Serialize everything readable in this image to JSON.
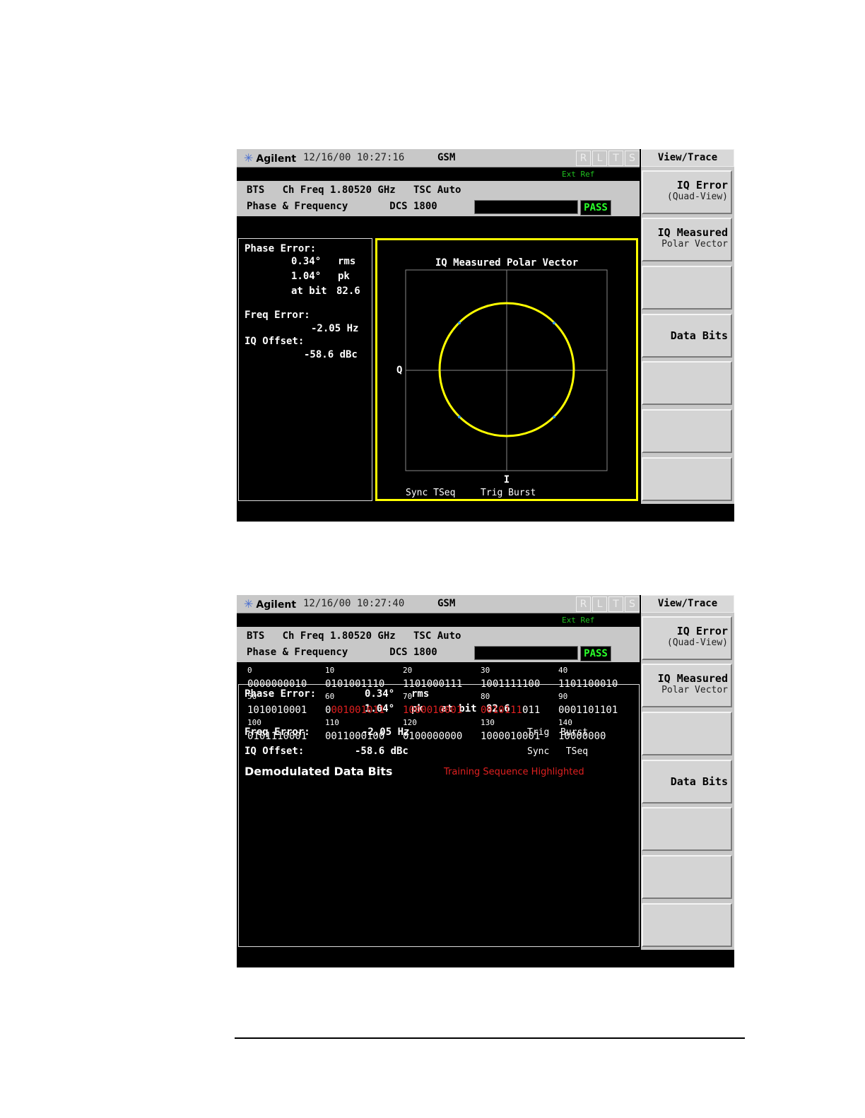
{
  "screen1": {
    "brand": "Agilent",
    "timestamp": "12/16/00 10:27:16",
    "mode": "GSM",
    "status_letters": [
      "R",
      "L",
      "T",
      "S"
    ],
    "ext_ref": "Ext Ref",
    "header_line1": "BTS   Ch Freq 1.80520 GHz   TSC Auto",
    "header_line2": "Phase & Frequency       DCS 1800",
    "pass": "PASS",
    "results": {
      "phase_error_label": "Phase Error:",
      "rms_value": "0.34°",
      "rms_unit": "rms",
      "pk_value": "1.04°",
      "pk_unit": "pk",
      "at_bit_label": "at bit",
      "at_bit_value": "82.6",
      "freq_error_label": "Freq Error:",
      "freq_error_value": "-2.05 Hz",
      "iq_offset_label": "IQ Offset:",
      "iq_offset_value": "-58.6 dBc"
    },
    "graph": {
      "title": "IQ Measured Polar Vector",
      "y_axis": "Q",
      "x_axis": "I",
      "sync_label": "Sync TSeq",
      "trig_label": "Trig Burst"
    }
  },
  "screen2": {
    "brand": "Agilent",
    "timestamp": "12/16/00 10:27:40",
    "mode": "GSM",
    "status_letters": [
      "R",
      "L",
      "T",
      "S"
    ],
    "ext_ref": "Ext Ref",
    "header_line1": "BTS   Ch Freq 1.80520 GHz   TSC Auto",
    "header_line2": "Phase & Frequency       DCS 1800",
    "pass": "PASS",
    "results": {
      "phase_error_label": "Phase Error:",
      "rms_value": "0.34°",
      "rms_unit": "rms",
      "pk_value": "1.04°",
      "pk_unit": "pk",
      "at_bit_label": "at bit",
      "at_bit_value": "82.6",
      "freq_error_label": "Freq Error:",
      "freq_error_value": "-2.05 Hz",
      "iq_offset_label": "IQ Offset:",
      "iq_offset_value": "-58.6 dBc",
      "trig_label": "Trig  Burst",
      "sync_label": "Sync   TSeq"
    },
    "data_bits_title": "Demodulated Data Bits",
    "training_note": "Training Sequence Highlighted",
    "bit_rows": [
      {
        "labels": [
          "0",
          "10",
          "20",
          "30",
          "40"
        ],
        "groups": [
          {
            "plain": "0000000010",
            "red": "",
            "tail": ""
          },
          {
            "plain": "0101001110",
            "red": "",
            "tail": ""
          },
          {
            "plain": "1101000111",
            "red": "",
            "tail": ""
          },
          {
            "plain": "1001111100",
            "red": "",
            "tail": ""
          },
          {
            "plain": "1101100010",
            "red": "",
            "tail": ""
          }
        ]
      },
      {
        "labels": [
          "50",
          "60",
          "70",
          "80",
          "90"
        ],
        "groups": [
          {
            "plain": "1010010001",
            "red": "",
            "tail": ""
          },
          {
            "plain": "0",
            "red": "001001011",
            "tail": ""
          },
          {
            "plain": "",
            "red": "1000010001",
            "tail": ""
          },
          {
            "plain": "",
            "red": "0010111",
            "tail": "011"
          },
          {
            "plain": "0001101101",
            "red": "",
            "tail": ""
          }
        ]
      },
      {
        "labels": [
          "100",
          "110",
          "120",
          "130",
          "140"
        ],
        "groups": [
          {
            "plain": "0101110001",
            "red": "",
            "tail": ""
          },
          {
            "plain": "0011000100",
            "red": "",
            "tail": ""
          },
          {
            "plain": "0100000000",
            "red": "",
            "tail": ""
          },
          {
            "plain": "1000010001",
            "red": "",
            "tail": ""
          },
          {
            "plain": "10000000",
            "red": "",
            "tail": ""
          }
        ]
      }
    ]
  },
  "softkeys": {
    "menu_title": "View/Trace",
    "iq_error_label": "IQ Error",
    "iq_error_sub": "(Quad-View)",
    "iq_measured_label": "IQ Measured",
    "iq_measured_sub": "Polar Vector",
    "data_bits_label": "Data Bits"
  },
  "colors": {
    "pass_green": "#2aff2a",
    "highlight_red": "#e02020",
    "graph_border_yellow": "#ffff00",
    "trace_yellow": "#ffff00",
    "ext_ref_green": "#1fc11f"
  }
}
